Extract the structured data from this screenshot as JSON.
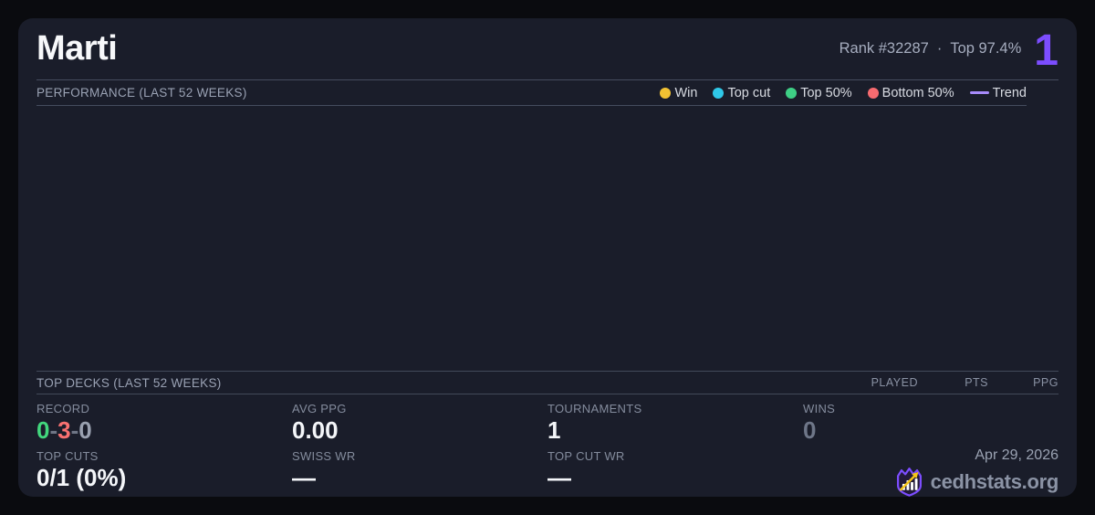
{
  "header": {
    "player_name": "Marti",
    "rank_label": "Rank #32287",
    "separator": "·",
    "top_percent": "Top 97.4%",
    "rank_number": "1"
  },
  "performance": {
    "section_title": "PERFORMANCE (LAST 52 WEEKS)",
    "legend": [
      {
        "label": "Win",
        "color": "#f2c233",
        "swatch": "dot"
      },
      {
        "label": "Top cut",
        "color": "#2fc8e8",
        "swatch": "dot"
      },
      {
        "label": "Top 50%",
        "color": "#3ecf85",
        "swatch": "dot"
      },
      {
        "label": "Bottom 50%",
        "color": "#f76b70",
        "swatch": "dot"
      },
      {
        "label": "Trend",
        "color": "#a78bfa",
        "swatch": "line"
      }
    ]
  },
  "chart_data": {
    "type": "scatter",
    "title": "PERFORMANCE (LAST 52 WEEKS)",
    "series": [
      {
        "name": "Win",
        "points": []
      },
      {
        "name": "Top cut",
        "points": []
      },
      {
        "name": "Top 50%",
        "points": []
      },
      {
        "name": "Bottom 50%",
        "points": []
      },
      {
        "name": "Trend",
        "points": []
      }
    ],
    "note": "chart area is empty - no data points or trend line plotted"
  },
  "top_decks": {
    "section_title": "TOP DECKS (LAST 52 WEEKS)",
    "columns": [
      "PLAYED",
      "PTS",
      "PPG"
    ]
  },
  "stats": {
    "record": {
      "label": "RECORD",
      "wins": "0",
      "losses": "3",
      "draws": "0",
      "separator": "-"
    },
    "avg_ppg": {
      "label": "AVG PPG",
      "value": "0.00"
    },
    "tournaments": {
      "label": "TOURNAMENTS",
      "value": "1"
    },
    "wins": {
      "label": "WINS",
      "value": "0"
    },
    "top_cuts": {
      "label": "TOP CUTS",
      "value": "0/1 (0%)"
    },
    "swiss_wr": {
      "label": "SWISS WR",
      "value": "—"
    },
    "top_cut_wr": {
      "label": "TOP CUT WR",
      "value": "—"
    }
  },
  "footer": {
    "date": "Apr 29, 2026",
    "brand": "cedhstats.org"
  },
  "colors": {
    "page_background": "#0a0b0f",
    "card_background": "#1a1d2a",
    "divider": "#454c5e",
    "accent_purple": "#7c4dff",
    "trend_purple": "#a78bfa",
    "win_yellow": "#f2c233",
    "topcut_cyan": "#2fc8e8",
    "top50_green": "#3ecf85",
    "bottom50_red": "#f76b70",
    "record_win_green": "#42d77d",
    "record_loss_red": "#f87171",
    "muted_value_gray": "#6e7688"
  }
}
